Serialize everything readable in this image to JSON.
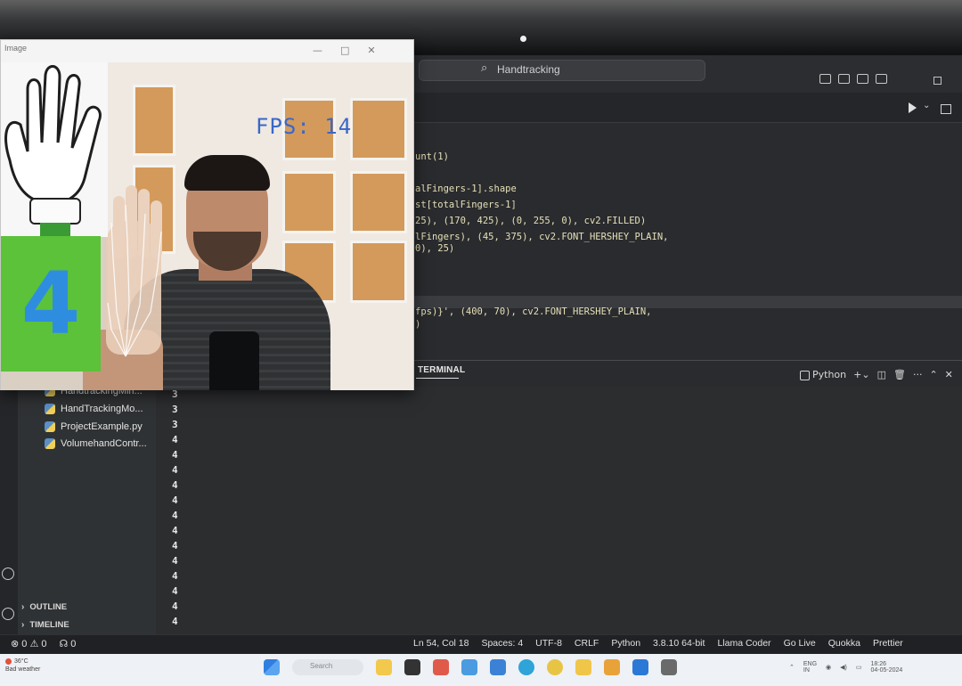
{
  "vscode": {
    "search_text": "Handtracking",
    "code_lines": [
      "unt(1)",
      "alFingers-1].shape",
      "st[totalFingers-1]",
      "25), (170, 425), (0, 255, 0), cv2.FILLED)",
      "lFingers), (45, 375), cv2.FONT_HERSHEY_PLAIN,",
      "0), 25)",
      "fps)}', (400, 70), cv2.FONT_HERSHEY_PLAIN,",
      ")"
    ],
    "panel": {
      "active_tab": "TERMINAL",
      "shell_label": "Python",
      "add_icon": "plus-icon",
      "split_icon": "split-terminal-icon",
      "trash_icon": "trash-icon"
    },
    "explorer": {
      "files": [
        {
          "name": "HandtrackingMin...",
          "icon": "python-file-icon"
        },
        {
          "name": "HandTrackingMo...",
          "icon": "python-file-icon"
        },
        {
          "name": "ProjectExample.py",
          "icon": "python-file-icon"
        },
        {
          "name": "VolumehandContr...",
          "icon": "python-file-icon"
        }
      ],
      "sections": [
        "OUTLINE",
        "TIMELINE"
      ]
    },
    "terminal_output": [
      "3",
      "3",
      "3",
      "4",
      "4",
      "4",
      "4",
      "4",
      "4",
      "4",
      "4",
      "4",
      "4",
      "4",
      "4",
      "4"
    ],
    "statusbar": {
      "errors": "⊗ 0 ⚠ 0",
      "ports": "☊ 0",
      "position": "Ln 54, Col 18",
      "spaces": "Spaces: 4",
      "encoding": "UTF-8",
      "eol": "CRLF",
      "language": "Python",
      "interpreter": "3.8.10 64-bit",
      "llama": "Llama Coder",
      "golive": "Go Live",
      "quokka": "Quokka",
      "prettier": "Prettier"
    }
  },
  "camera_window": {
    "title": "Image",
    "fps_text": "FPS: 14",
    "finger_count": "4",
    "count_box_color": "#5bc23a",
    "count_text_color": "#2f8de0"
  },
  "taskbar": {
    "weather_temp": "36°C",
    "weather_desc": "Bad weather",
    "search_placeholder": "Search",
    "lang": "ENG",
    "lang2": "IN",
    "time": "18:26",
    "date": "04-05-2024"
  }
}
